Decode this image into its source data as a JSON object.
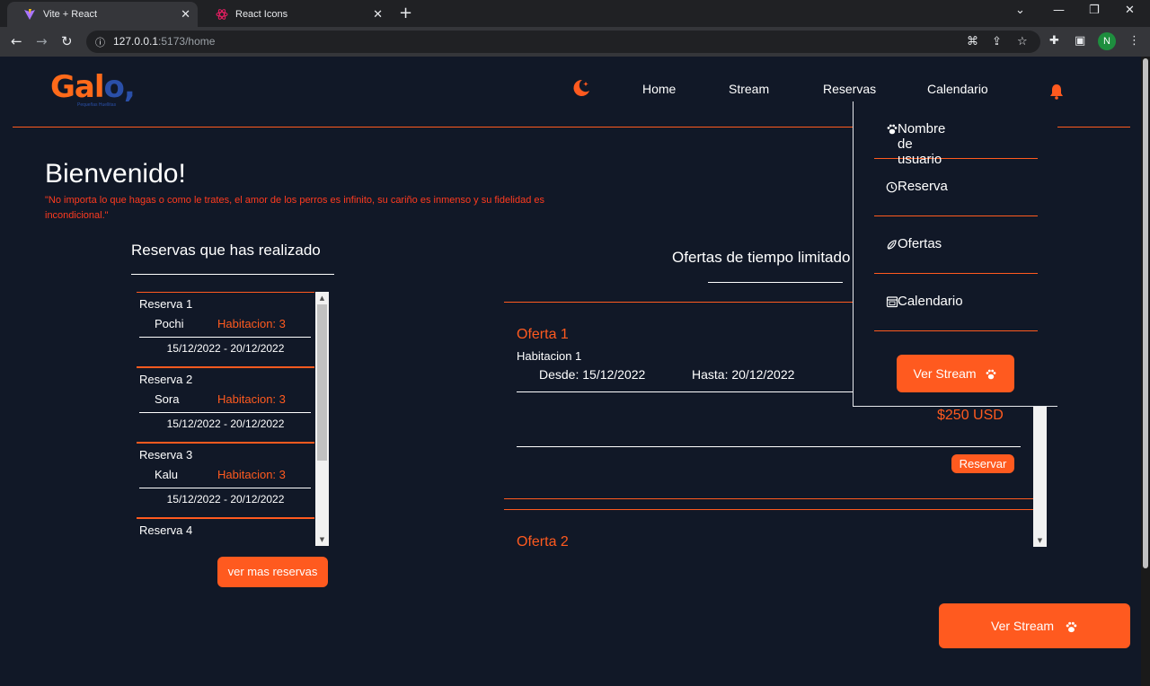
{
  "browser": {
    "tabs": [
      {
        "title": "Vite + React",
        "active": true
      },
      {
        "title": "React Icons",
        "active": false
      }
    ],
    "url_host": "127.0.0.1",
    "url_path": ":5173/home"
  },
  "header": {
    "logo_text": "Gal",
    "logo_sub": "Pequeñas Huellitas",
    "nav": [
      "Home",
      "Stream",
      "Reservas",
      "Calendario"
    ]
  },
  "dropdown": {
    "items": [
      {
        "label": "Nombre de usuario",
        "icon": "paw-icon"
      },
      {
        "label": "Reserva",
        "icon": "clock-icon"
      },
      {
        "label": "Ofertas",
        "icon": "tag-icon"
      },
      {
        "label": "Calendario",
        "icon": "calendar-icon"
      }
    ],
    "button_label": "Ver Stream"
  },
  "welcome": {
    "title": "Bienvenido!",
    "quote": "\"No importa lo que hagas o como le trates, el amor de los perros es infinito, su cariño es inmenso y su fidelidad es incondicional.\""
  },
  "reservations": {
    "title": "Reservas que has realizado",
    "items": [
      {
        "name": "Reserva 1",
        "pet": "Pochi",
        "room": "Habitacion: 3",
        "dates": "15/12/2022 - 20/12/2022"
      },
      {
        "name": "Reserva 2",
        "pet": "Sora",
        "room": "Habitacion: 3",
        "dates": "15/12/2022 - 20/12/2022"
      },
      {
        "name": "Reserva 3",
        "pet": "Kalu",
        "room": "Habitacion: 3",
        "dates": "15/12/2022 - 20/12/2022"
      },
      {
        "name": "Reserva 4",
        "pet": "",
        "room": "",
        "dates": ""
      }
    ],
    "more_button": "ver mas reservas"
  },
  "offers": {
    "title": "Ofertas de tiempo limitado",
    "items": [
      {
        "name": "Oferta 1",
        "room": "Habitacion 1",
        "from": "Desde: 15/12/2022",
        "to": "Hasta: 20/12/2022",
        "price": "$250 USD",
        "button": "Reservar"
      },
      {
        "name": "Oferta 2"
      }
    ]
  },
  "floating_button": "Ver Stream",
  "colors": {
    "accent": "#ff5a1f",
    "background": "#111827"
  }
}
